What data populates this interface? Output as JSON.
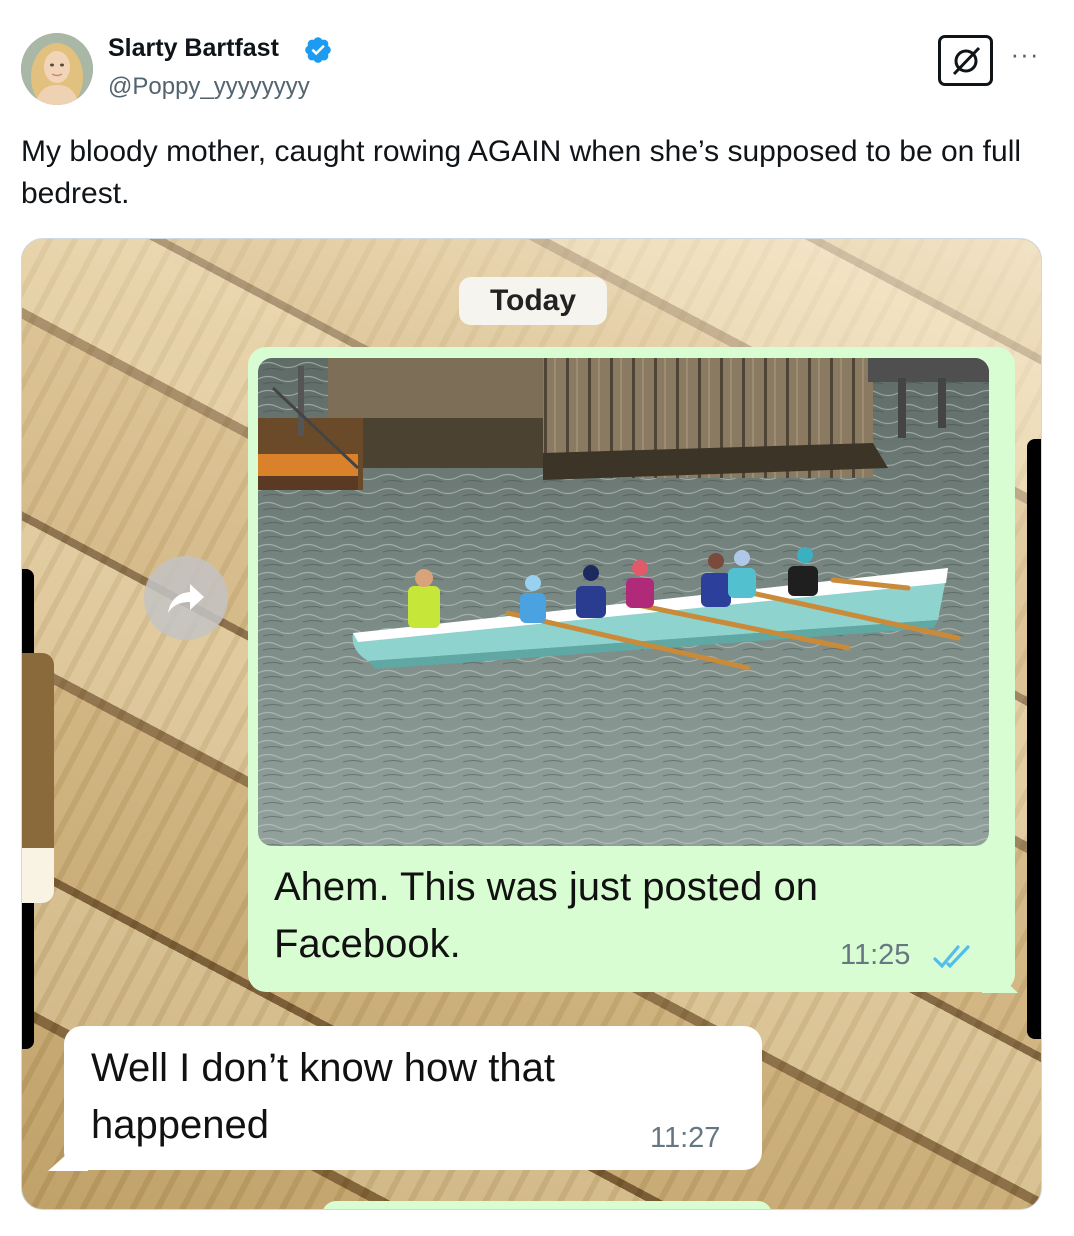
{
  "post": {
    "author_name": "Slarty Bartfast",
    "author_handle": "@Poppy_yyyyyyyy",
    "verified_icon": "verified-badge-icon",
    "text": "My bloody mother, caught rowing AGAIN when she’s supposed to be on full bedrest.",
    "more_label": "···",
    "grok_icon": "grok-icon"
  },
  "chat": {
    "date_label": "Today",
    "forward_icon": "forward-arrow-icon",
    "outgoing": {
      "text": "Ahem. This was just posted on Facebook.",
      "time": "11:25",
      "status_icon": "double-check-read-icon",
      "photo": "rowing-boat-photo"
    },
    "incoming": {
      "text": "Well I don’t know how that happened",
      "time": "11:27"
    }
  },
  "colors": {
    "outgoing_bubble": "#d9fdd3",
    "incoming_bubble": "#ffffff",
    "verified_blue": "#1d9bf0",
    "read_tick_blue": "#53bdeb",
    "secondary_text": "#536471"
  }
}
